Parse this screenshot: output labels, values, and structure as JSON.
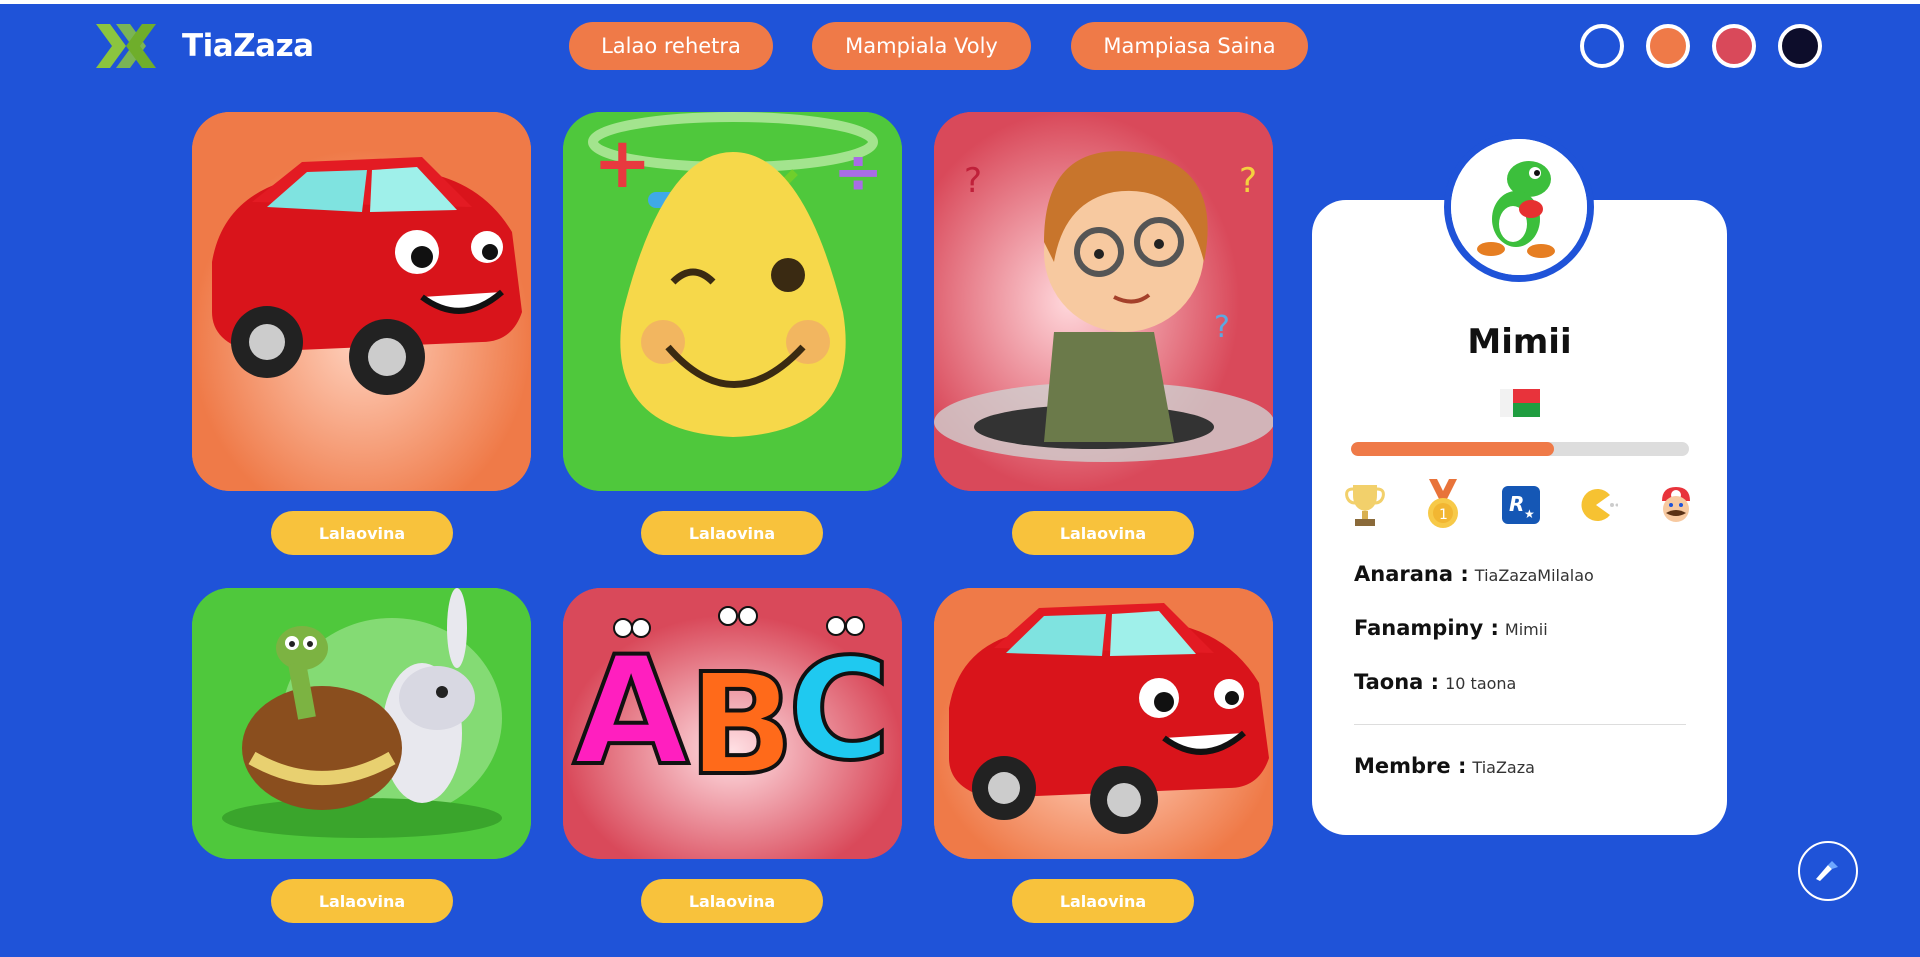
{
  "brand": {
    "name": "TiaZaza"
  },
  "nav": [
    {
      "label": "Lalao rehetra"
    },
    {
      "label": "Mampiala Voly"
    },
    {
      "label": "Mampiasa Saina"
    }
  ],
  "theme_colors": [
    "#1f53d8",
    "#ef7a48",
    "#d9495a",
    "#0d0d2b"
  ],
  "games": [
    {
      "image": "red-car-illustration",
      "bg": "#ef7a48",
      "button": "Lalaovina"
    },
    {
      "image": "math-smiley-illustration",
      "bg": "#4fc83c",
      "button": "Lalaovina"
    },
    {
      "image": "thinking-boy-illustration",
      "bg": "#d9495a",
      "button": "Lalaovina"
    },
    {
      "image": "turtle-rabbit-illustration",
      "bg": "#4fc83c",
      "button": "Lalaovina"
    },
    {
      "image": "abc-letters-illustration",
      "bg": "#d9495a",
      "button": "Lalaovina"
    },
    {
      "image": "red-car-illustration",
      "bg": "#ef7a48",
      "button": "Lalaovina"
    }
  ],
  "profile": {
    "avatar": "yoshi-avatar",
    "name": "Mimii",
    "flag": "madagascar-flag",
    "progress": 0.6,
    "badges": [
      "trophy-icon",
      "medal-icon",
      "rockstar-icon",
      "pacman-icon",
      "mario-icon"
    ],
    "fields": [
      {
        "label": "Anarana :",
        "value": "TiaZazaMilalao"
      },
      {
        "label": "Fanampiny :",
        "value": "Mimii"
      },
      {
        "label": "Taona :",
        "value": "10 taona"
      }
    ],
    "member": {
      "label": "Membre :",
      "value": "TiaZaza"
    }
  }
}
